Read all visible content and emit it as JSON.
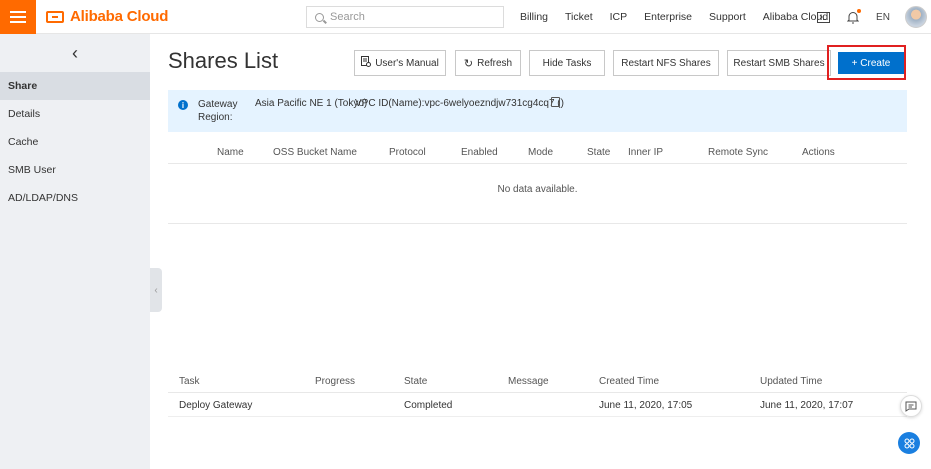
{
  "header": {
    "logo": "Alibaba Cloud",
    "search_placeholder": "Search",
    "nav": [
      "Billing",
      "Ticket",
      "ICP",
      "Enterprise",
      "Support",
      "Alibaba Cloud"
    ],
    "language": "EN",
    "icons": [
      "menu-icon",
      "terminal-icon",
      "bell-icon",
      "avatar"
    ]
  },
  "sidebar": {
    "back": "‹",
    "items": [
      "Share",
      "Details",
      "Cache",
      "SMB User",
      "AD/LDAP/DNS"
    ],
    "active": "Share"
  },
  "page": {
    "title": "Shares List",
    "buttons": {
      "manual": "User's Manual",
      "refresh": "Refresh",
      "hide_tasks": "Hide Tasks",
      "restart_nfs": "Restart NFS Shares",
      "restart_smb": "Restart SMB Shares",
      "create": "+ Create"
    }
  },
  "info": {
    "region_label": "Gateway Region:",
    "region_value": "Asia Pacific NE 1 (Tokyo)",
    "vpc": "VPC ID(Name):vpc-6welyoezndjw731cg4cq7 ()"
  },
  "shares_table": {
    "columns": [
      "Name",
      "OSS Bucket Name",
      "Protocol",
      "Enabled",
      "Mode",
      "State",
      "Inner IP",
      "Remote Sync",
      "Actions"
    ],
    "empty_text": "No data available."
  },
  "tasks_table": {
    "columns": [
      "Task",
      "Progress",
      "State",
      "Message",
      "Created Time",
      "Updated Time"
    ],
    "rows": [
      {
        "task": "Deploy Gateway",
        "progress": "",
        "state": "Completed",
        "message": "",
        "created": "June 11, 2020, 17:05",
        "updated": "June 11, 2020, 17:07"
      }
    ]
  },
  "colors": {
    "brand": "#ff6a00",
    "primary": "#0070cc",
    "info_bg": "#e5f3ff",
    "highlight": "#e02020"
  }
}
